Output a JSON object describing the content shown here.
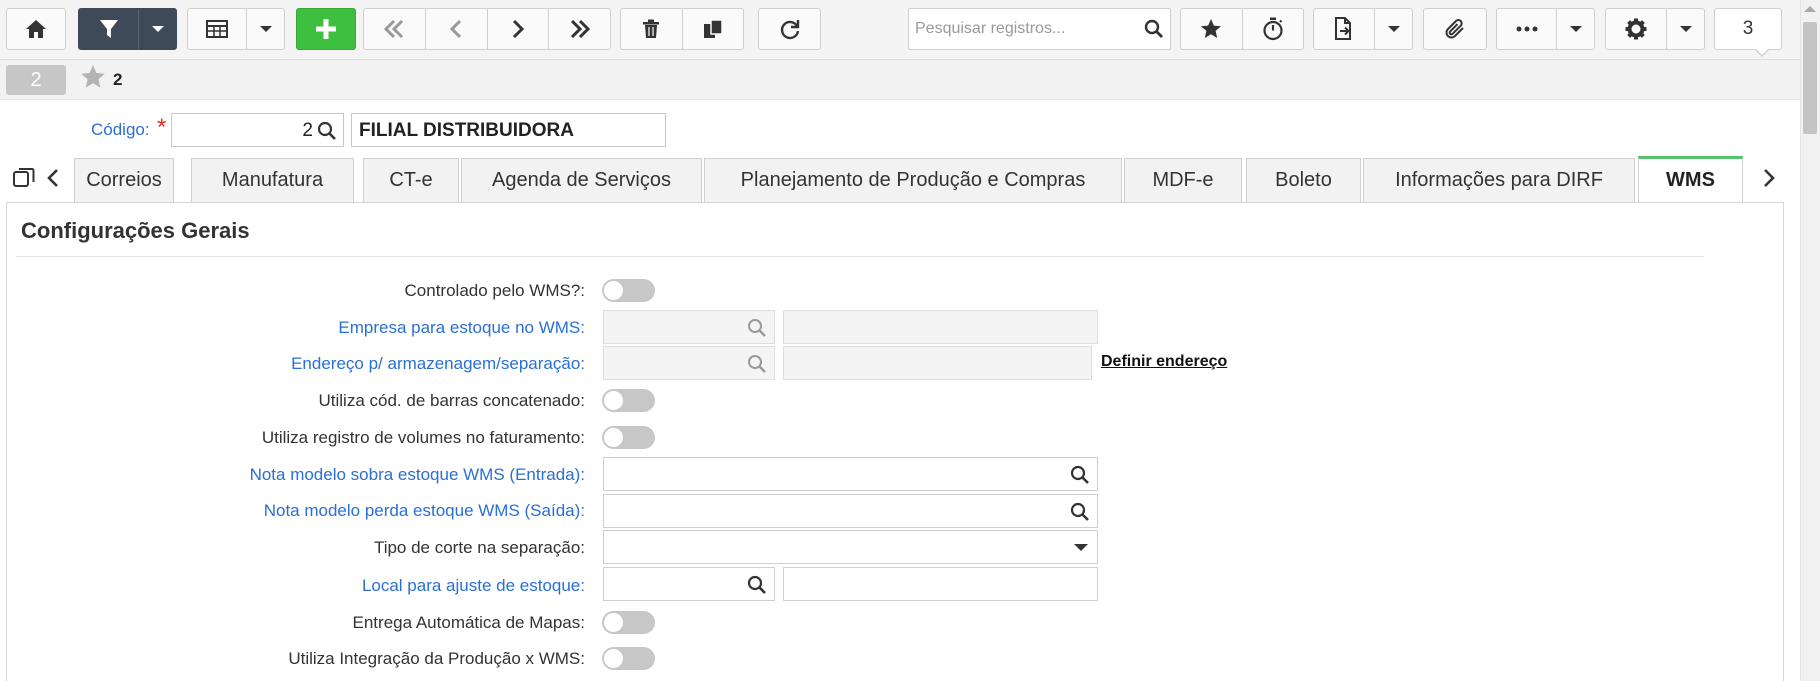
{
  "toolbar": {
    "search_placeholder": "Pesquisar registros...",
    "record_counter": "3"
  },
  "record": {
    "badge": "2",
    "favorites_count": "2"
  },
  "header": {
    "codigo_label": "Código:",
    "required_mark": "*",
    "codigo_value": "2",
    "name_value": "FILIAL DISTRIBUIDORA"
  },
  "tabs": [
    {
      "label": "Correios"
    },
    {
      "label": "Manufatura"
    },
    {
      "label": "CT-e"
    },
    {
      "label": "Agenda de Serviços"
    },
    {
      "label": "Planejamento de Produção e Compras"
    },
    {
      "label": "MDF-e"
    },
    {
      "label": "Boleto"
    },
    {
      "label": "Informações para DIRF"
    },
    {
      "label": "WMS"
    }
  ],
  "active_tab": "WMS",
  "section": {
    "title": "Configurações Gerais"
  },
  "fields": {
    "controlado_wms": {
      "label": "Controlado pelo WMS?:",
      "value": false
    },
    "empresa_estoque": {
      "label": "Empresa para estoque no WMS:"
    },
    "endereco_armazenagem": {
      "label": "Endereço p/ armazenagem/separação:",
      "link": "Definir endereço"
    },
    "cod_barras_concatenado": {
      "label": "Utiliza cód. de barras concatenado:",
      "value": false
    },
    "registro_volumes": {
      "label": "Utiliza registro de volumes no faturamento:",
      "value": false
    },
    "nota_sobra": {
      "label": "Nota modelo sobra estoque WMS (Entrada):"
    },
    "nota_perda": {
      "label": "Nota modelo perda estoque WMS (Saída):"
    },
    "tipo_corte": {
      "label": "Tipo de corte na separação:"
    },
    "local_ajuste": {
      "label": "Local para ajuste de estoque:"
    },
    "entrega_mapas": {
      "label": "Entrega Automática de Mapas:",
      "value": false
    },
    "integracao_producao": {
      "label": "Utiliza Integração da Produção x WMS:",
      "value": false
    }
  },
  "colors": {
    "link_label": "#2a6fd6",
    "active_tab_accent": "#56c26b",
    "primary_dark": "#3f4a59",
    "add_green": "#3fbf3f",
    "required": "#d9302c"
  },
  "icons": [
    "home-icon",
    "filter-icon",
    "grid-icon",
    "plus-icon",
    "first-icon",
    "prev-icon",
    "next-icon",
    "last-icon",
    "trash-icon",
    "copy-icon",
    "refresh-icon",
    "search-icon",
    "star-icon",
    "stopwatch-icon",
    "export-icon",
    "paperclip-icon",
    "more-icon",
    "gear-icon",
    "duplicate-tabs-icon",
    "chevron-left-icon",
    "chevron-right-icon"
  ]
}
